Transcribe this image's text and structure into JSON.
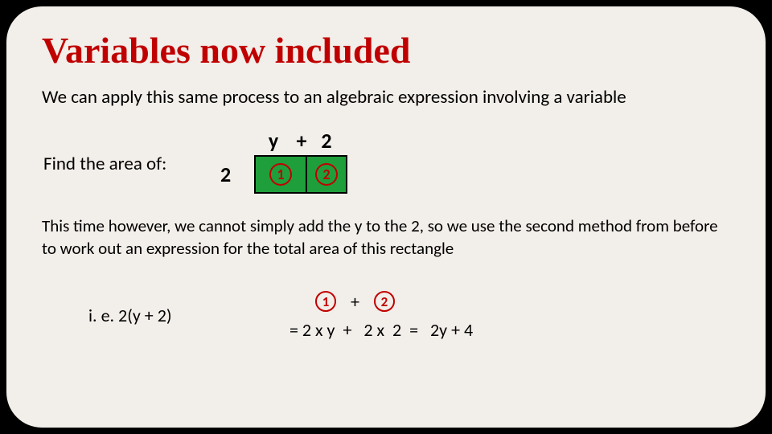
{
  "title": "Variables now included",
  "intro": "We can apply this same process to an algebraic expression involving a variable",
  "figure": {
    "find_label": "Find the area of:",
    "side": "2",
    "top_y": "y",
    "top_plus": "+",
    "top_2": "2",
    "region1": "1",
    "region2": "2"
  },
  "middle": "This time however, we cannot simply add the y to the 2, so we use the second method from before to work out an expression for the total area of this rectangle",
  "bottom": {
    "ie": "i. e.   2(y + 2)",
    "c1": "1",
    "plus": "+",
    "c2": "2",
    "line2_a": "= 2 x y",
    "line2_b": "+   2 x  2",
    "line2_c": "=   2y + 4"
  }
}
